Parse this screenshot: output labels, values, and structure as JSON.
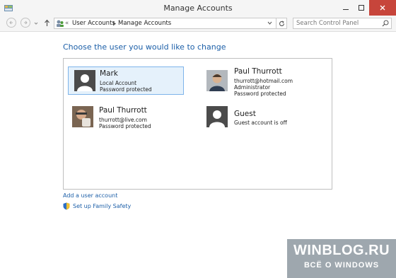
{
  "window": {
    "title": "Manage Accounts"
  },
  "navigation": {
    "breadcrumb_prefix": "«",
    "breadcrumb": [
      "User Accounts",
      "Manage Accounts"
    ],
    "search_placeholder": "Search Control Panel"
  },
  "main": {
    "heading": "Choose the user you would like to change",
    "accounts": [
      {
        "name": "Mark",
        "lines": [
          "Local Account",
          "Password protected"
        ],
        "selected": true
      },
      {
        "name": "Paul Thurrott",
        "lines": [
          "thurrott@hotmail.com",
          "Administrator",
          "Password protected"
        ]
      },
      {
        "name": "Paul Thurrott",
        "lines": [
          "thurrott@live.com",
          "Password protected"
        ]
      },
      {
        "name": "Guest",
        "lines": [
          "Guest account is off"
        ]
      }
    ],
    "links": {
      "add_user": "Add a user account",
      "family_safety": "Set up Family Safety"
    }
  },
  "watermark": {
    "line1": "WINBLOG.RU",
    "line2": "ВСЁ О WINDOWS"
  },
  "colors": {
    "accent": "#1c5fa8",
    "selection": "#e5f1fb",
    "close": "#c7453b"
  }
}
